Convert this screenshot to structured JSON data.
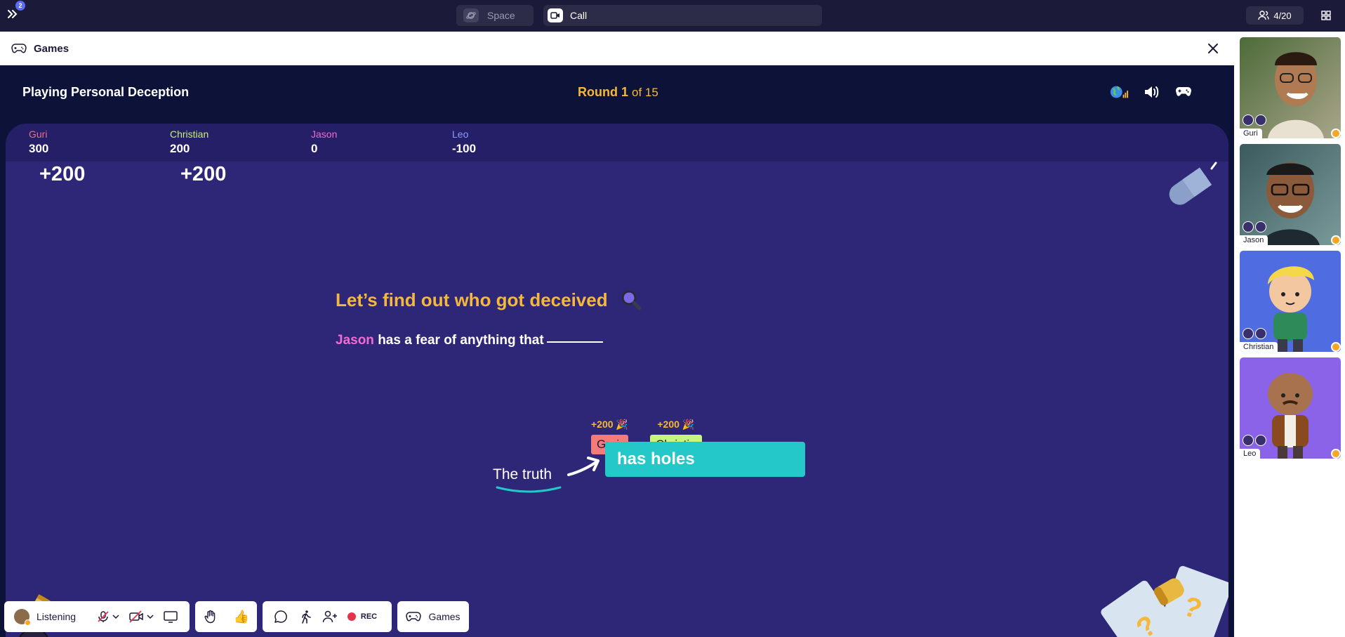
{
  "topbar": {
    "notification_count": "2",
    "space_label": "Space",
    "call_label": "Call",
    "participants": "4/20"
  },
  "games_header": {
    "title": "Games"
  },
  "game": {
    "playing_title": "Playing Personal Deception",
    "round_prefix": "Round",
    "round_number": "1",
    "round_total": "of 15",
    "scores": [
      {
        "name": "Guri",
        "points": "300",
        "color": "#f06b8a",
        "delta": "+200"
      },
      {
        "name": "Christian",
        "points": "200",
        "color": "#c9f06b",
        "delta": "+200"
      },
      {
        "name": "Jason",
        "points": "0",
        "color": "#f06bd2",
        "delta": ""
      },
      {
        "name": "Leo",
        "points": "-100",
        "color": "#8b9bff",
        "delta": ""
      }
    ],
    "headline": "Let’s find out who got deceived",
    "prompt": {
      "player": "Jason",
      "text": "has a fear of anything that"
    },
    "votes": [
      {
        "bonus": "+200",
        "name": "Guri",
        "color": "#f57a7a"
      },
      {
        "bonus": "+200",
        "name": "Christia",
        "color": "#c8f57a"
      }
    ],
    "truth_label": "The truth",
    "answer": "has holes"
  },
  "toolbar": {
    "status": "Listening",
    "rec_label": "REC",
    "games_label": "Games"
  },
  "sidebar": {
    "participants": [
      {
        "name": "Guri",
        "bg": "#6b7a55"
      },
      {
        "name": "Jason",
        "bg": "#4c6a6d"
      },
      {
        "name": "Christian",
        "bg": "#4f6de0"
      },
      {
        "name": "Leo",
        "bg": "#8a63e8"
      }
    ]
  }
}
